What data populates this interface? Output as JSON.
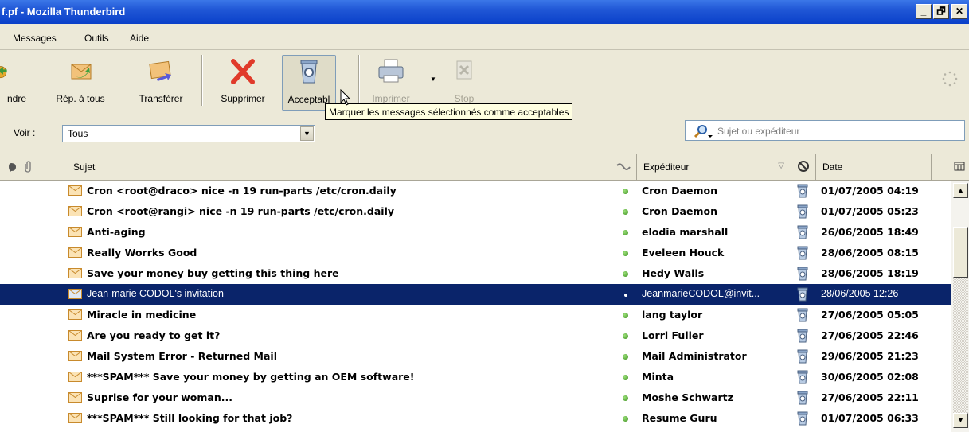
{
  "window": {
    "title": "f.pf - Mozilla Thunderbird",
    "minimize": "_",
    "maximize": "🗗",
    "close": "✕"
  },
  "menu": [
    "Messages",
    "Outils",
    "Aide"
  ],
  "toolbar": {
    "reply_partial": "ndre",
    "reply_all": "Rép. à tous",
    "forward": "Transférer",
    "delete": "Supprimer",
    "accept": "Acceptabl",
    "print": "Imprimer",
    "stop": "Stop"
  },
  "tooltip": "Marquer les messages sélectionnés comme acceptables",
  "filter": {
    "label": "Voir :",
    "value": "Tous",
    "search_placeholder": "Sujet ou expéditeur"
  },
  "columns": {
    "subject": "Sujet",
    "sender": "Expéditeur",
    "date": "Date"
  },
  "messages": [
    {
      "subject": "Cron <root@draco> nice -n 19 run-parts /etc/cron.daily",
      "sender": "Cron Daemon",
      "date": "01/07/2005 04:19"
    },
    {
      "subject": "Cron <root@rangi> nice -n 19 run-parts /etc/cron.daily",
      "sender": "Cron Daemon",
      "date": "01/07/2005 05:23"
    },
    {
      "subject": "Anti-aging",
      "sender": "elodia marshall",
      "date": "26/06/2005 18:49"
    },
    {
      "subject": "Really Worrks Good",
      "sender": "Eveleen Houck",
      "date": "28/06/2005 08:15"
    },
    {
      "subject": "Save your money buy getting this thing here",
      "sender": "Hedy Walls",
      "date": "28/06/2005 18:19"
    },
    {
      "subject": "Jean-marie CODOL's invitation",
      "sender": "JeanmarieCODOL@invit...",
      "date": "28/06/2005 12:26"
    },
    {
      "subject": "Miracle  in medicine",
      "sender": "lang taylor",
      "date": "27/06/2005 05:05"
    },
    {
      "subject": "Are you ready to get it?",
      "sender": "Lorri Fuller",
      "date": "27/06/2005 22:46"
    },
    {
      "subject": "Mail System Error - Returned Mail",
      "sender": "Mail Administrator",
      "date": "29/06/2005 21:23"
    },
    {
      "subject": "***SPAM*** Save your money by getting an OEM software!",
      "sender": "Minta",
      "date": "30/06/2005 02:08"
    },
    {
      "subject": "Suprise for your woman...",
      "sender": "Moshe Schwartz",
      "date": "27/06/2005 22:11"
    },
    {
      "subject": "***SPAM*** Still looking for that job?",
      "sender": "Resume Guru",
      "date": "01/07/2005 06:33"
    }
  ],
  "selected_row": 5,
  "colors": {
    "selection": "#0a246a",
    "titlebar": "#0a40c9",
    "tooltip_bg": "#ffffe1"
  }
}
